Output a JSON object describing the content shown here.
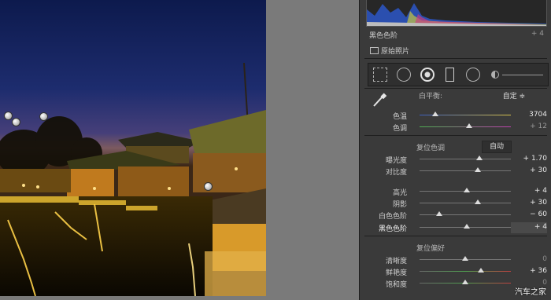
{
  "histogram": {
    "label": "黑色色阶",
    "value": "+ 4",
    "original_photo_label": "原始照片"
  },
  "white_balance": {
    "label": "白平衡:",
    "preset": "自定 ≑",
    "temp_label": "色温",
    "temp_value": "3704",
    "tint_label": "色调",
    "tint_value": "+ 12"
  },
  "tone": {
    "title": "复位色调",
    "auto_label": "自动",
    "rows": [
      {
        "label": "曝光度",
        "value": "+ 1.70"
      },
      {
        "label": "对比度",
        "value": "+ 30"
      },
      {
        "label": "高光",
        "value": "+ 4"
      },
      {
        "label": "阴影",
        "value": "+ 30"
      },
      {
        "label": "白色色阶",
        "value": "− 60"
      },
      {
        "label": "黑色色阶",
        "value": "+ 4"
      }
    ]
  },
  "presence": {
    "title": "复位偏好",
    "rows": [
      {
        "label": "清晰度",
        "value": "0"
      },
      {
        "label": "鲜艳度",
        "value": "+ 36"
      },
      {
        "label": "饱和度",
        "value": "0"
      }
    ]
  },
  "watermark": "汽车之家",
  "slider_levels": {
    "temp": 0.18,
    "tint": 0.55,
    "exposure": 0.67,
    "contrast": 0.65,
    "highlights": 0.52,
    "shadows": 0.65,
    "whites": 0.22,
    "blacks": 0.52,
    "clarity": 0.5,
    "vibrance": 0.68,
    "saturation": 0.5
  },
  "colors": {
    "panel_bg": "#3a3a3a",
    "canvas_bg": "#7a7a7a"
  },
  "icons": {
    "eyedropper": "eyedropper-icon",
    "crop": "crop-overlay-icon",
    "spot": "spot-removal-icon",
    "redeye": "red-eye-icon",
    "graduated": "graduated-filter-icon",
    "radial": "radial-filter-icon",
    "brush": "adjustment-brush-icon"
  }
}
